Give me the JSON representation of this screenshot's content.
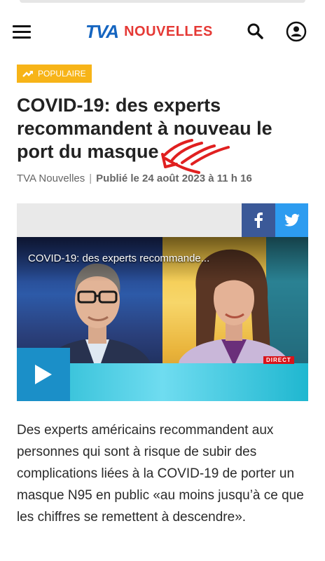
{
  "header": {
    "logo_tva": "TVA",
    "logo_nouvelles": "NOUVELLES"
  },
  "article": {
    "badge": "POPULAIRE",
    "headline": "COVID-19: des experts recommandent à nouveau le port du masque",
    "source": "TVA Nouvelles",
    "separator": "|",
    "published": "Publié le 24 août 2023 à 11 h 16",
    "video_title": "COVID-19: des experts recommande...",
    "video_live_tag": "DIRECT",
    "body": "Des experts américains recommandent aux personnes qui sont à risque de subir des complications liées à la COVID-19 de porter un masque N95 en public «au moins jusqu’à ce que les chiffres se remettent à descendre»."
  },
  "icons": {
    "menu": "hamburger-menu-icon",
    "search": "search-icon",
    "account": "user-account-icon",
    "trending": "trending-up-icon",
    "facebook": "facebook-icon",
    "twitter": "twitter-icon",
    "play": "play-icon"
  },
  "colors": {
    "brand_blue": "#1565c0",
    "brand_red": "#e53935",
    "badge": "#f7b418",
    "facebook": "#3b5998",
    "twitter": "#2d9cf0",
    "annotation_red": "#e02020"
  }
}
